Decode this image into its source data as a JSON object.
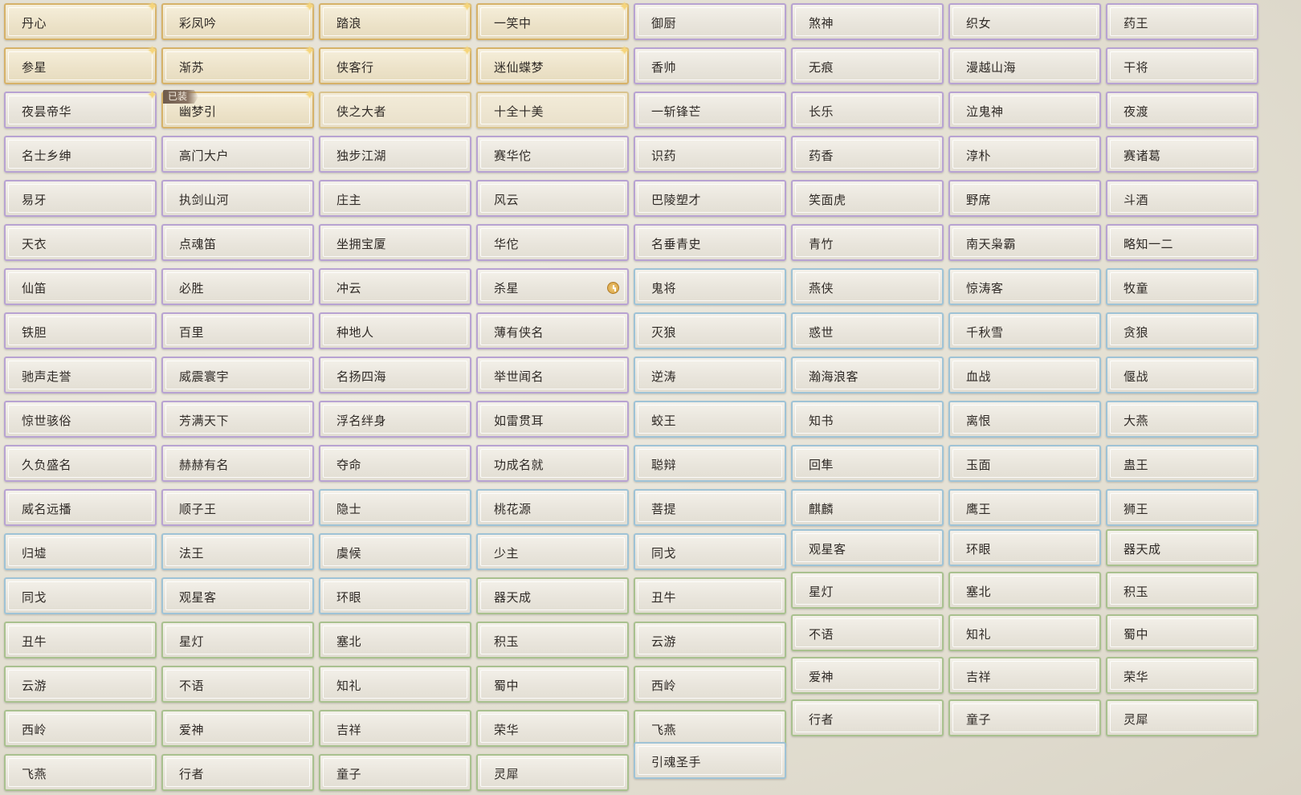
{
  "colors": {
    "gold": "#d6b269",
    "purple": "#b8a3d2",
    "blue": "#9fc3d6",
    "green": "#a9c18f"
  },
  "columns": [
    [
      {
        "label": "丹心",
        "tier": "gold",
        "spark": true
      },
      {
        "label": "参星",
        "tier": "gold",
        "spark": true
      },
      {
        "label": "夜昙帝华",
        "tier": "purple",
        "spark": true
      },
      {
        "label": "名士乡绅",
        "tier": "purple"
      },
      {
        "label": "易牙",
        "tier": "purple"
      },
      {
        "label": "天衣",
        "tier": "purple"
      },
      {
        "label": "仙笛",
        "tier": "purple"
      },
      {
        "label": "铁胆",
        "tier": "purple"
      },
      {
        "label": "驰声走誉",
        "tier": "purple"
      },
      {
        "label": "惊世骇俗",
        "tier": "purple"
      },
      {
        "label": "久负盛名",
        "tier": "purple"
      },
      {
        "label": "威名远播",
        "tier": "purple"
      },
      {
        "label": "归墟",
        "tier": "blue"
      },
      {
        "label": "同戈",
        "tier": "blue"
      },
      {
        "label": "丑牛",
        "tier": "green"
      },
      {
        "label": "云游",
        "tier": "green"
      },
      {
        "label": "西岭",
        "tier": "green"
      },
      {
        "label": "飞燕",
        "tier": "green"
      }
    ],
    [
      {
        "label": "彩凤吟",
        "tier": "gold",
        "spark": true
      },
      {
        "label": "渐苏",
        "tier": "gold",
        "spark": true
      },
      {
        "label": "幽梦引",
        "tier": "gold",
        "spark": true,
        "badge": "已装"
      },
      {
        "label": "高门大户",
        "tier": "purple"
      },
      {
        "label": "执剑山河",
        "tier": "purple"
      },
      {
        "label": "点魂笛",
        "tier": "purple"
      },
      {
        "label": "必胜",
        "tier": "purple"
      },
      {
        "label": "百里",
        "tier": "purple"
      },
      {
        "label": "威震寰宇",
        "tier": "purple"
      },
      {
        "label": "芳满天下",
        "tier": "purple"
      },
      {
        "label": "赫赫有名",
        "tier": "purple"
      },
      {
        "label": "顺子王",
        "tier": "purple"
      },
      {
        "label": "法王",
        "tier": "blue"
      },
      {
        "label": "观星客",
        "tier": "blue"
      },
      {
        "label": "星灯",
        "tier": "green"
      },
      {
        "label": "不语",
        "tier": "green"
      },
      {
        "label": "爱神",
        "tier": "green"
      },
      {
        "label": "行者",
        "tier": "green"
      }
    ],
    [
      {
        "label": "踏浪",
        "tier": "gold",
        "spark": true
      },
      {
        "label": "侠客行",
        "tier": "gold",
        "spark": true
      },
      {
        "label": "侠之大者",
        "tier": "gold-plain"
      },
      {
        "label": "独步江湖",
        "tier": "purple"
      },
      {
        "label": "庄主",
        "tier": "purple"
      },
      {
        "label": "坐拥宝厦",
        "tier": "purple"
      },
      {
        "label": "冲云",
        "tier": "purple"
      },
      {
        "label": "种地人",
        "tier": "purple"
      },
      {
        "label": "名扬四海",
        "tier": "purple"
      },
      {
        "label": "浮名绊身",
        "tier": "purple"
      },
      {
        "label": "夺命",
        "tier": "purple"
      },
      {
        "label": "隐士",
        "tier": "blue"
      },
      {
        "label": "虞候",
        "tier": "blue"
      },
      {
        "label": "环眼",
        "tier": "blue"
      },
      {
        "label": "塞北",
        "tier": "green"
      },
      {
        "label": "知礼",
        "tier": "green"
      },
      {
        "label": "吉祥",
        "tier": "green"
      },
      {
        "label": "童子",
        "tier": "green"
      }
    ],
    [
      {
        "label": "一笑中",
        "tier": "gold",
        "spark": true
      },
      {
        "label": "迷仙蝶梦",
        "tier": "gold",
        "spark": true
      },
      {
        "label": "十全十美",
        "tier": "gold-plain"
      },
      {
        "label": "赛华佗",
        "tier": "purple"
      },
      {
        "label": "风云",
        "tier": "purple"
      },
      {
        "label": "华佗",
        "tier": "purple"
      },
      {
        "label": "杀星",
        "tier": "purple",
        "clock": true
      },
      {
        "label": "薄有侠名",
        "tier": "purple"
      },
      {
        "label": "举世闻名",
        "tier": "purple"
      },
      {
        "label": "如雷贯耳",
        "tier": "purple"
      },
      {
        "label": "功成名就",
        "tier": "purple"
      },
      {
        "label": "桃花源",
        "tier": "blue"
      },
      {
        "label": "少主",
        "tier": "blue"
      },
      {
        "label": "器天成",
        "tier": "green"
      },
      {
        "label": "积玉",
        "tier": "green"
      },
      {
        "label": "蜀中",
        "tier": "green"
      },
      {
        "label": "荣华",
        "tier": "green"
      },
      {
        "label": "灵犀",
        "tier": "green"
      }
    ],
    [
      {
        "label": "御厨",
        "tier": "purple"
      },
      {
        "label": "香帅",
        "tier": "purple"
      },
      {
        "label": "一斩锋芒",
        "tier": "purple"
      },
      {
        "label": "识药",
        "tier": "purple"
      },
      {
        "label": "巴陵塑才",
        "tier": "purple"
      },
      {
        "label": "名垂青史",
        "tier": "purple"
      },
      {
        "label": "鬼将",
        "tier": "blue"
      },
      {
        "label": "灭狼",
        "tier": "blue"
      },
      {
        "label": "逆涛",
        "tier": "blue"
      },
      {
        "label": "蛟王",
        "tier": "blue"
      },
      {
        "label": "聪辩",
        "tier": "blue"
      },
      {
        "label": "菩提",
        "tier": "blue"
      },
      {
        "label": "同戈",
        "tier": "blue"
      },
      {
        "label": "丑牛",
        "tier": "green"
      },
      {
        "label": "云游",
        "tier": "green"
      },
      {
        "label": "西岭",
        "tier": "green"
      },
      {
        "label": "飞燕",
        "tier": "green"
      },
      {
        "label": "引魂圣手",
        "tier": "blue"
      }
    ],
    [
      {
        "label": "煞神",
        "tier": "purple"
      },
      {
        "label": "无痕",
        "tier": "purple"
      },
      {
        "label": "长乐",
        "tier": "purple"
      },
      {
        "label": "药香",
        "tier": "purple"
      },
      {
        "label": "笑面虎",
        "tier": "purple"
      },
      {
        "label": "青竹",
        "tier": "purple"
      },
      {
        "label": "燕侠",
        "tier": "blue"
      },
      {
        "label": "惑世",
        "tier": "blue"
      },
      {
        "label": "瀚海浪客",
        "tier": "blue"
      },
      {
        "label": "知书",
        "tier": "blue"
      },
      {
        "label": "回隼",
        "tier": "blue"
      },
      {
        "label": "麒麟",
        "tier": "blue"
      },
      {
        "label": "观星客",
        "tier": "blue"
      },
      {
        "label": "星灯",
        "tier": "green"
      },
      {
        "label": "不语",
        "tier": "green"
      },
      {
        "label": "爱神",
        "tier": "green"
      },
      {
        "label": "行者",
        "tier": "green"
      }
    ],
    [
      {
        "label": "织女",
        "tier": "purple"
      },
      {
        "label": "漫越山海",
        "tier": "purple"
      },
      {
        "label": "泣鬼神",
        "tier": "purple"
      },
      {
        "label": "淳朴",
        "tier": "purple"
      },
      {
        "label": "野席",
        "tier": "purple"
      },
      {
        "label": "南天枭霸",
        "tier": "purple"
      },
      {
        "label": "惊涛客",
        "tier": "blue"
      },
      {
        "label": "千秋雪",
        "tier": "blue"
      },
      {
        "label": "血战",
        "tier": "blue"
      },
      {
        "label": "离恨",
        "tier": "blue"
      },
      {
        "label": "玉面",
        "tier": "blue"
      },
      {
        "label": "鹰王",
        "tier": "blue"
      },
      {
        "label": "环眼",
        "tier": "blue"
      },
      {
        "label": "塞北",
        "tier": "green"
      },
      {
        "label": "知礼",
        "tier": "green"
      },
      {
        "label": "吉祥",
        "tier": "green"
      },
      {
        "label": "童子",
        "tier": "green"
      }
    ],
    [
      {
        "label": "药王",
        "tier": "purple"
      },
      {
        "label": "干将",
        "tier": "purple"
      },
      {
        "label": "夜渡",
        "tier": "purple"
      },
      {
        "label": "赛诸葛",
        "tier": "purple"
      },
      {
        "label": "斗酒",
        "tier": "purple"
      },
      {
        "label": "略知一二",
        "tier": "purple"
      },
      {
        "label": "牧童",
        "tier": "blue"
      },
      {
        "label": "贪狼",
        "tier": "blue"
      },
      {
        "label": "偃战",
        "tier": "blue"
      },
      {
        "label": "大燕",
        "tier": "blue"
      },
      {
        "label": "蛊王",
        "tier": "blue"
      },
      {
        "label": "狮王",
        "tier": "blue"
      },
      {
        "label": "器天成",
        "tier": "green"
      },
      {
        "label": "积玉",
        "tier": "green"
      },
      {
        "label": "蜀中",
        "tier": "green"
      },
      {
        "label": "荣华",
        "tier": "green"
      },
      {
        "label": "灵犀",
        "tier": "green"
      }
    ]
  ]
}
